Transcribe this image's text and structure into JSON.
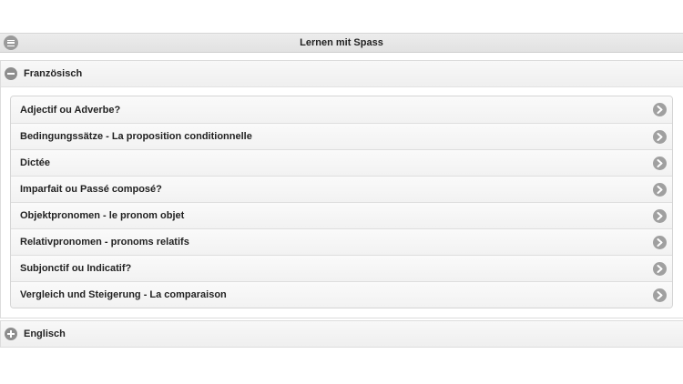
{
  "header": {
    "title": "Lernen mit Spass",
    "menu_icon": "menu-icon"
  },
  "sections": [
    {
      "title": "Französisch",
      "state": "expanded",
      "icon": "minus-icon",
      "items": [
        {
          "label": "Adjectif ou Adverbe?"
        },
        {
          "label": "Bedingungssätze - La proposition conditionnelle"
        },
        {
          "label": "Dictée"
        },
        {
          "label": "Imparfait ou Passé composé?"
        },
        {
          "label": "Objektpronomen - le pronom objet"
        },
        {
          "label": "Relativpronomen - pronoms relatifs"
        },
        {
          "label": "Subjonctif ou Indicatif?"
        },
        {
          "label": "Vergleich und Steigerung - La comparaison"
        }
      ]
    },
    {
      "title": "Englisch",
      "state": "collapsed",
      "icon": "plus-icon",
      "items": []
    }
  ]
}
